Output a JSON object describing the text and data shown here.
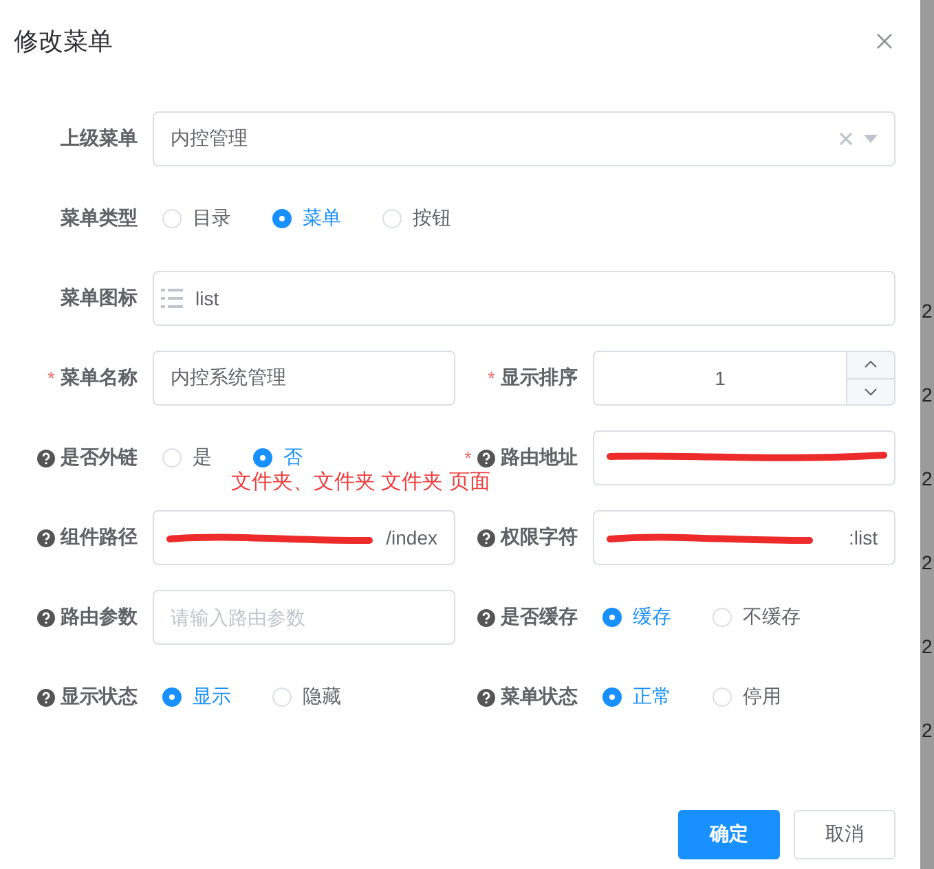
{
  "dialog": {
    "title": "修改菜单"
  },
  "rows": [
    [
      {
        "kind": "select",
        "label": "上级菜单",
        "help": false,
        "value": "内控管理"
      }
    ],
    [
      {
        "kind": "radio",
        "label": "菜单类型",
        "help": false,
        "options": [
          {
            "label": "目录",
            "selected": false
          },
          {
            "label": "菜单",
            "selected": true
          },
          {
            "label": "按钮",
            "selected": false
          }
        ]
      }
    ],
    [
      {
        "kind": "icon_input",
        "label": "菜单图标",
        "help": false,
        "value": "list"
      }
    ],
    [
      {
        "kind": "input",
        "label": "菜单名称",
        "required_mark": "*",
        "help": false,
        "value": "内控系统管理"
      },
      {
        "kind": "number",
        "label": "显示排序",
        "required_mark": "*",
        "help": false,
        "value": "1"
      }
    ],
    [
      {
        "kind": "radio",
        "label": "是否外链",
        "help": true,
        "options": [
          {
            "label": "是",
            "selected": false
          },
          {
            "label": "否",
            "selected": true
          }
        ]
      },
      {
        "kind": "input",
        "label": "路由地址",
        "required_mark": "*",
        "help": true,
        "redacted": true
      }
    ],
    [
      {
        "kind": "input",
        "label": "组件路径",
        "help": true,
        "value": "/index",
        "redacted": true
      },
      {
        "kind": "input",
        "label": "权限字符",
        "help": true,
        "value": ":list",
        "redacted": true
      }
    ],
    [
      {
        "kind": "input",
        "label": "路由参数",
        "help": true,
        "placeholder": "请输入路由参数"
      },
      {
        "kind": "radio",
        "label": "是否缓存",
        "help": true,
        "options": [
          {
            "label": "缓存",
            "selected": true
          },
          {
            "label": "不缓存",
            "selected": false
          }
        ]
      }
    ],
    [
      {
        "kind": "radio",
        "label": "显示状态",
        "help": true,
        "options": [
          {
            "label": "显示",
            "selected": true
          },
          {
            "label": "隐藏",
            "selected": false
          }
        ]
      },
      {
        "kind": "radio",
        "label": "菜单状态",
        "help": true,
        "options": [
          {
            "label": "正常",
            "selected": true
          },
          {
            "label": "停用",
            "selected": false
          }
        ]
      }
    ]
  ],
  "annotation": {
    "text": "文件夹、文件夹 文件夹 页面"
  },
  "buttons": [
    {
      "label": "确定",
      "kind": "primary"
    },
    {
      "label": "取消",
      "kind": "default"
    }
  ],
  "background_column": [
    "2",
    "2",
    "2",
    "2",
    "2",
    "2"
  ]
}
